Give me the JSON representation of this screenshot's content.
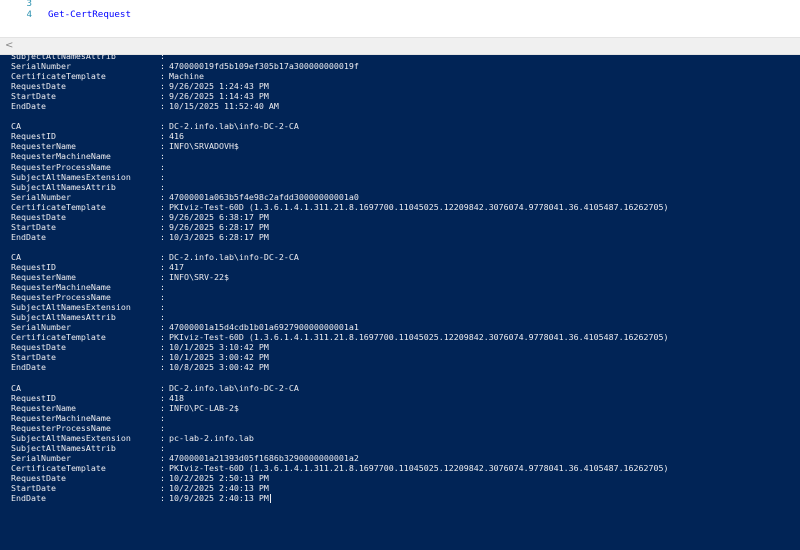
{
  "editor": {
    "lines": [
      {
        "num": "3",
        "code": ""
      },
      {
        "num": "4",
        "code": "Get-CertRequest"
      }
    ],
    "scroll_left_arrow": "<"
  },
  "console": {
    "top_partial": [
      {
        "key": "SubjectAltNamesAttrib",
        "value": ""
      },
      {
        "key": "SerialNumber",
        "value": "470000019fd5b109ef305b17a300000000019f"
      },
      {
        "key": "CertificateTemplate",
        "value": "Machine"
      },
      {
        "key": "RequestDate",
        "value": "9/26/2025 1:24:43 PM"
      },
      {
        "key": "StartDate",
        "value": "9/26/2025 1:14:43 PM"
      },
      {
        "key": "EndDate",
        "value": "10/15/2025 11:52:40 AM"
      }
    ],
    "records": [
      {
        "fields": [
          {
            "key": "CA",
            "value": "DC-2.info.lab\\info-DC-2-CA"
          },
          {
            "key": "RequestID",
            "value": "416"
          },
          {
            "key": "RequesterName",
            "value": "INFO\\SRVADOVH$"
          },
          {
            "key": "RequesterMachineName",
            "value": ""
          },
          {
            "key": "RequesterProcessName",
            "value": ""
          },
          {
            "key": "SubjectAltNamesExtension",
            "value": ""
          },
          {
            "key": "SubjectAltNamesAttrib",
            "value": ""
          },
          {
            "key": "SerialNumber",
            "value": "47000001a063b5f4e98c2afdd30000000001a0"
          },
          {
            "key": "CertificateTemplate",
            "value": "PKIviz-Test-60D (1.3.6.1.4.1.311.21.8.1697700.11045025.12209842.3076074.9778041.36.4105487.16262705)"
          },
          {
            "key": "RequestDate",
            "value": "9/26/2025 6:38:17 PM"
          },
          {
            "key": "StartDate",
            "value": "9/26/2025 6:28:17 PM"
          },
          {
            "key": "EndDate",
            "value": "10/3/2025 6:28:17 PM"
          }
        ]
      },
      {
        "fields": [
          {
            "key": "CA",
            "value": "DC-2.info.lab\\info-DC-2-CA"
          },
          {
            "key": "RequestID",
            "value": "417"
          },
          {
            "key": "RequesterName",
            "value": "INFO\\SRV-22$"
          },
          {
            "key": "RequesterMachineName",
            "value": ""
          },
          {
            "key": "RequesterProcessName",
            "value": ""
          },
          {
            "key": "SubjectAltNamesExtension",
            "value": ""
          },
          {
            "key": "SubjectAltNamesAttrib",
            "value": ""
          },
          {
            "key": "SerialNumber",
            "value": "47000001a15d4cdb1b01a692790000000001a1"
          },
          {
            "key": "CertificateTemplate",
            "value": "PKIviz-Test-60D (1.3.6.1.4.1.311.21.8.1697700.11045025.12209842.3076074.9778041.36.4105487.16262705)"
          },
          {
            "key": "RequestDate",
            "value": "10/1/2025 3:10:42 PM"
          },
          {
            "key": "StartDate",
            "value": "10/1/2025 3:00:42 PM"
          },
          {
            "key": "EndDate",
            "value": "10/8/2025 3:00:42 PM"
          }
        ]
      },
      {
        "fields": [
          {
            "key": "CA",
            "value": "DC-2.info.lab\\info-DC-2-CA"
          },
          {
            "key": "RequestID",
            "value": "418"
          },
          {
            "key": "RequesterName",
            "value": "INFO\\PC-LAB-2$"
          },
          {
            "key": "RequesterMachineName",
            "value": ""
          },
          {
            "key": "RequesterProcessName",
            "value": ""
          },
          {
            "key": "SubjectAltNamesExtension",
            "value": "pc-lab-2.info.lab"
          },
          {
            "key": "SubjectAltNamesAttrib",
            "value": ""
          },
          {
            "key": "SerialNumber",
            "value": "47000001a21393d05f1686b3290000000001a2"
          },
          {
            "key": "CertificateTemplate",
            "value": "PKIviz-Test-60D (1.3.6.1.4.1.311.21.8.1697700.11045025.12209842.3076074.9778041.36.4105487.16262705)"
          },
          {
            "key": "RequestDate",
            "value": "10/2/2025 2:50:13 PM"
          },
          {
            "key": "StartDate",
            "value": "10/2/2025 2:40:13 PM"
          },
          {
            "key": "EndDate",
            "value": "10/9/2025 2:40:13 PM"
          }
        ]
      }
    ]
  },
  "colors": {
    "console_background": "#012456",
    "console_text": "#eeedf0",
    "line_number": "#2b91af",
    "keyword": "#0000ff"
  }
}
